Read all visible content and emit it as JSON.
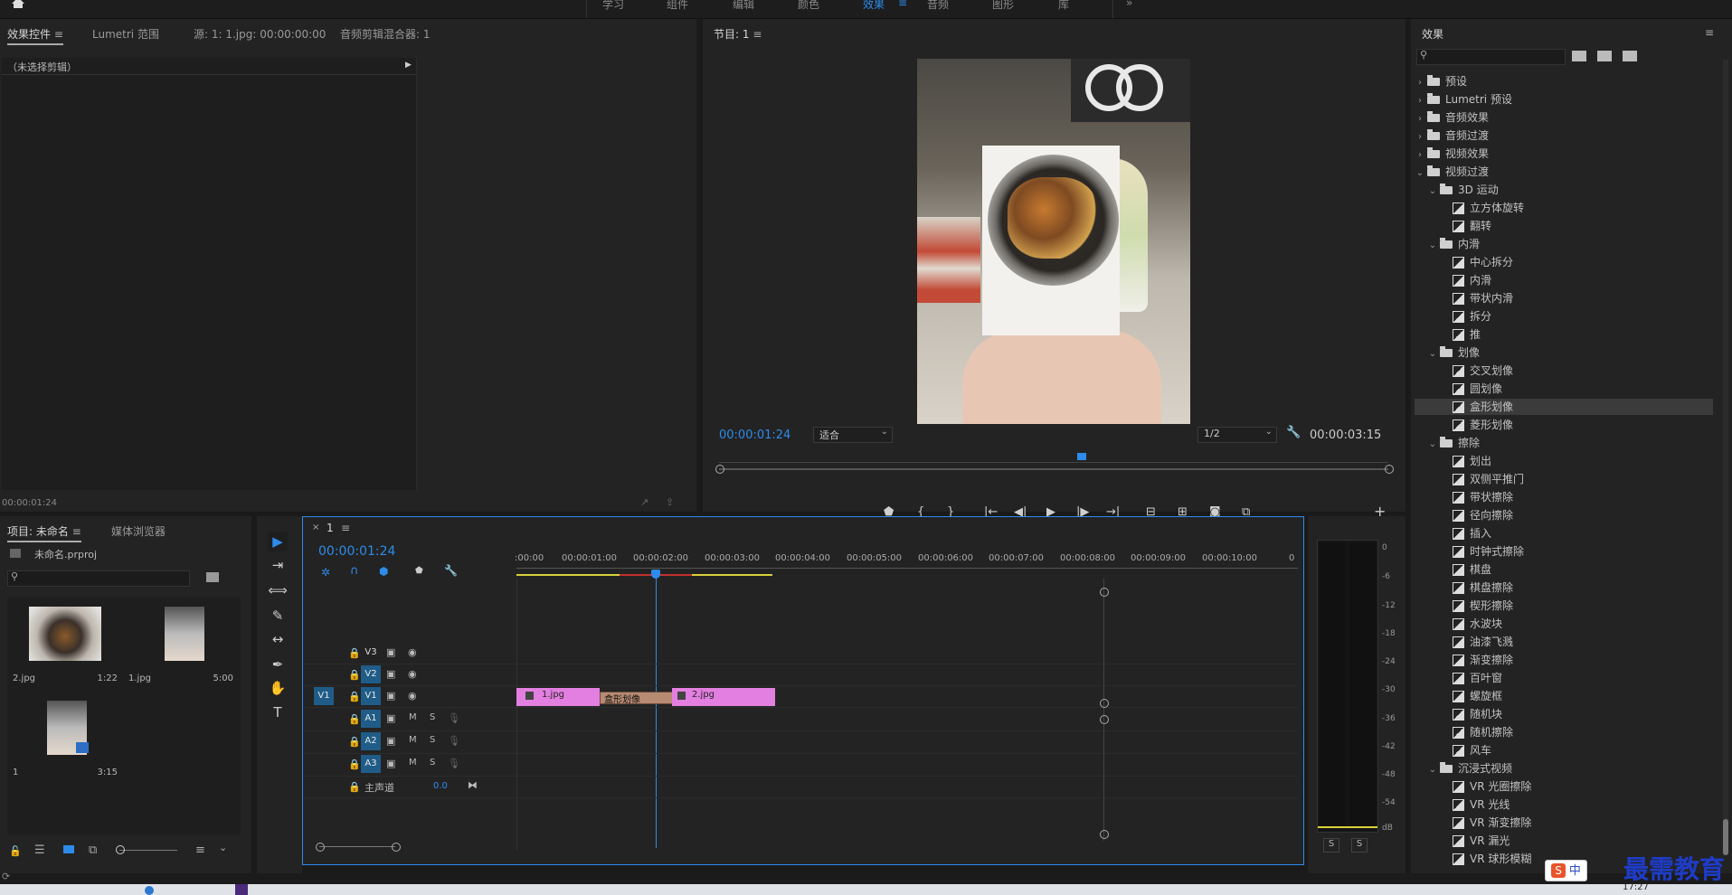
{
  "workspaces": [
    "学习",
    "组件",
    "编辑",
    "颜色",
    "效果",
    "音频",
    "图形",
    "库"
  ],
  "workspace_selected": "效果",
  "source_panel": {
    "tabs": [
      "效果控件",
      "Lumetri 范围",
      "源: 1: 1.jpg: 00:00:00:00",
      "音频剪辑混合器: 1"
    ],
    "no_clip": "（未选择剪辑）",
    "timecode": "00:00:01:24"
  },
  "program": {
    "title": "节目: 1",
    "timecode": "00:00:01:24",
    "fit": "适合",
    "resolution": "1/2",
    "duration": "00:00:03:15"
  },
  "project": {
    "tabs": [
      "项目: 未命名",
      "媒体浏览器"
    ],
    "file": "未命名.prproj",
    "items": [
      {
        "name": "2.jpg",
        "duration": "1:22"
      },
      {
        "name": "1.jpg",
        "duration": "5:00"
      },
      {
        "name": "1",
        "duration": "3:15"
      }
    ]
  },
  "timeline": {
    "tab": "1",
    "timecode": "00:00:01:24",
    "ruler": [
      ":00:00",
      "00:00:01:00",
      "00:00:02:00",
      "00:00:03:00",
      "00:00:04:00",
      "00:00:05:00",
      "00:00:06:00",
      "00:00:07:00",
      "00:00:08:00",
      "00:00:09:00",
      "00:00:10:00",
      "0"
    ],
    "video_tracks": [
      "V3",
      "V2",
      "V1"
    ],
    "audio_tracks": [
      "A1",
      "A2",
      "A3"
    ],
    "source_patch": "V1",
    "master": "主声道",
    "master_value": "0.0",
    "clips": {
      "clip1": "1.jpg",
      "transition": "盒形划像",
      "clip2": "2.jpg"
    },
    "mute": "M",
    "solo": "S"
  },
  "meter": {
    "labels": [
      "0",
      "-6",
      "-12",
      "-18",
      "-24",
      "-30",
      "-36",
      "-42",
      "-48",
      "-54",
      "dB"
    ],
    "solo": [
      "S",
      "S"
    ]
  },
  "effects": {
    "title": "效果",
    "search_placeholder": "",
    "tree": [
      {
        "label": "预设",
        "level": 0,
        "type": "folder",
        "open": false
      },
      {
        "label": "Lumetri 预设",
        "level": 0,
        "type": "folder",
        "open": false
      },
      {
        "label": "音频效果",
        "level": 0,
        "type": "folder",
        "open": false
      },
      {
        "label": "音频过渡",
        "level": 0,
        "type": "folder",
        "open": false
      },
      {
        "label": "视频效果",
        "level": 0,
        "type": "folder",
        "open": false
      },
      {
        "label": "视频过渡",
        "level": 0,
        "type": "folder",
        "open": true
      },
      {
        "label": "3D 运动",
        "level": 1,
        "type": "folder",
        "open": true
      },
      {
        "label": "立方体旋转",
        "level": 2,
        "type": "fx"
      },
      {
        "label": "翻转",
        "level": 2,
        "type": "fx"
      },
      {
        "label": "内滑",
        "level": 1,
        "type": "folder",
        "open": true
      },
      {
        "label": "中心拆分",
        "level": 2,
        "type": "fx"
      },
      {
        "label": "内滑",
        "level": 2,
        "type": "fx"
      },
      {
        "label": "带状内滑",
        "level": 2,
        "type": "fx"
      },
      {
        "label": "拆分",
        "level": 2,
        "type": "fx"
      },
      {
        "label": "推",
        "level": 2,
        "type": "fx"
      },
      {
        "label": "划像",
        "level": 1,
        "type": "folder",
        "open": true
      },
      {
        "label": "交叉划像",
        "level": 2,
        "type": "fx"
      },
      {
        "label": "圆划像",
        "level": 2,
        "type": "fx"
      },
      {
        "label": "盒形划像",
        "level": 2,
        "type": "fx",
        "selected": true
      },
      {
        "label": "菱形划像",
        "level": 2,
        "type": "fx"
      },
      {
        "label": "擦除",
        "level": 1,
        "type": "folder",
        "open": true
      },
      {
        "label": "划出",
        "level": 2,
        "type": "fx"
      },
      {
        "label": "双侧平推门",
        "level": 2,
        "type": "fx"
      },
      {
        "label": "带状擦除",
        "level": 2,
        "type": "fx"
      },
      {
        "label": "径向擦除",
        "level": 2,
        "type": "fx"
      },
      {
        "label": "插入",
        "level": 2,
        "type": "fx"
      },
      {
        "label": "时钟式擦除",
        "level": 2,
        "type": "fx"
      },
      {
        "label": "棋盘",
        "level": 2,
        "type": "fx"
      },
      {
        "label": "棋盘擦除",
        "level": 2,
        "type": "fx"
      },
      {
        "label": "楔形擦除",
        "level": 2,
        "type": "fx"
      },
      {
        "label": "水波块",
        "level": 2,
        "type": "fx"
      },
      {
        "label": "油漆飞溅",
        "level": 2,
        "type": "fx"
      },
      {
        "label": "渐变擦除",
        "level": 2,
        "type": "fx"
      },
      {
        "label": "百叶窗",
        "level": 2,
        "type": "fx"
      },
      {
        "label": "螺旋框",
        "level": 2,
        "type": "fx"
      },
      {
        "label": "随机块",
        "level": 2,
        "type": "fx"
      },
      {
        "label": "随机擦除",
        "level": 2,
        "type": "fx"
      },
      {
        "label": "风车",
        "level": 2,
        "type": "fx"
      },
      {
        "label": "沉浸式视频",
        "level": 1,
        "type": "folder",
        "open": true
      },
      {
        "label": "VR 光圈擦除",
        "level": 2,
        "type": "fx"
      },
      {
        "label": "VR 光线",
        "level": 2,
        "type": "fx"
      },
      {
        "label": "VR 渐变擦除",
        "level": 2,
        "type": "fx"
      },
      {
        "label": "VR 漏光",
        "level": 2,
        "type": "fx"
      },
      {
        "label": "VR 球形模糊",
        "level": 2,
        "type": "fx"
      }
    ]
  },
  "watermark": "最需教育",
  "ime": "中",
  "clock": "17:27",
  "colors": {
    "accent": "#2d8ceb",
    "clip": "#e37fe0",
    "transition": "#b78a72",
    "track_on": "#1f5c88"
  }
}
